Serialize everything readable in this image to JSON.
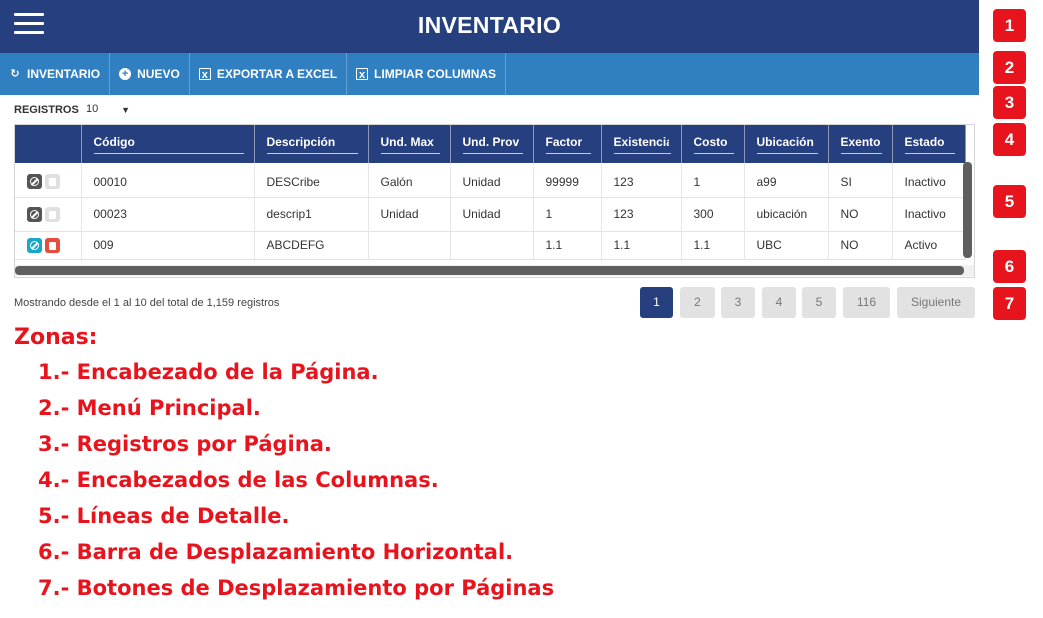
{
  "header": {
    "title": "INVENTARIO"
  },
  "menu": [
    {
      "icon": "refresh-icon",
      "label": "INVENTARIO"
    },
    {
      "icon": "plus-circle-icon",
      "label": "NUEVO"
    },
    {
      "icon": "excel-file-icon",
      "label": "EXPORTAR A EXCEL"
    },
    {
      "icon": "file-icon",
      "label": "LIMPIAR COLUMNAS"
    }
  ],
  "page_size": {
    "label": "REGISTROS",
    "value": "10"
  },
  "table": {
    "columns": [
      "",
      "Código",
      "Descripción",
      "Und. Max",
      "Und. Prov",
      "Factor",
      "Existencia",
      "Costo",
      "Ubicación",
      "Exento",
      "Estado"
    ],
    "rows": [
      {
        "active": false,
        "cells": [
          "00010",
          "DESCribe",
          "Galón",
          "Unidad",
          "99999",
          "123",
          "1",
          "a99",
          "SI",
          "Inactivo"
        ]
      },
      {
        "active": false,
        "cells": [
          "00023",
          "descrip1",
          "Unidad",
          "Unidad",
          "1",
          "123",
          "300",
          "ubicación",
          "NO",
          "Inactivo"
        ]
      },
      {
        "active": true,
        "cells": [
          "009",
          "ABCDEFG",
          "",
          "",
          "1.1",
          "1.1",
          "1.1",
          "UBC",
          "NO",
          "Activo"
        ]
      }
    ]
  },
  "summary": "Mostrando desde el 1 al 10 del total de 1,159 registros",
  "pagination": {
    "pages": [
      "1",
      "2",
      "3",
      "4",
      "5",
      "116"
    ],
    "current": "1",
    "next_label": "Siguiente"
  },
  "zones": {
    "title": "Zonas:",
    "items": [
      "1.- Encabezado de la Página.",
      "2.- Menú Principal.",
      "3.- Registros por Página.",
      "4.- Encabezados de las Columnas.",
      "5.- Líneas de Detalle.",
      "6.- Barra de Desplazamiento Horizontal.",
      "7.- Botones de Desplazamiento por Páginas"
    ]
  },
  "badges": [
    "1",
    "2",
    "3",
    "4",
    "5",
    "6",
    "7"
  ],
  "colors": {
    "header": "#263f7e",
    "menu": "#2f7fc1",
    "annotation": "#e8141d",
    "active_page": "#263f7e"
  }
}
